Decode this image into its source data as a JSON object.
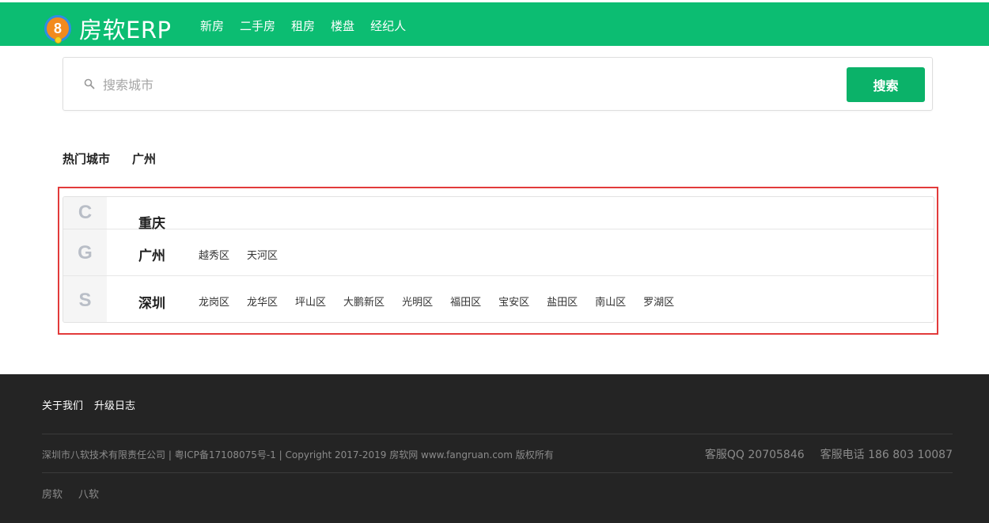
{
  "header": {
    "logo_number": "8",
    "brand": "房软ERP",
    "nav": [
      "新房",
      "二手房",
      "租房",
      "楼盘",
      "经纪人"
    ],
    "brand_color": "#0cbd72"
  },
  "search": {
    "placeholder": "搜索城市",
    "value": "",
    "button_label": "搜索",
    "button_color": "#0bb269"
  },
  "hot_cities": {
    "label": "热门城市",
    "cities": [
      "广州"
    ]
  },
  "city_groups": [
    {
      "letter": "C",
      "city": "重庆",
      "districts": []
    },
    {
      "letter": "G",
      "city": "广州",
      "districts": [
        "越秀区",
        "天河区"
      ]
    },
    {
      "letter": "S",
      "city": "深圳",
      "districts": [
        "龙岗区",
        "龙华区",
        "坪山区",
        "大鹏新区",
        "光明区",
        "福田区",
        "宝安区",
        "盐田区",
        "南山区",
        "罗湖区"
      ]
    }
  ],
  "footer": {
    "links": [
      "关于我们",
      "升级日志"
    ],
    "copyright": "深圳市八软技术有限责任公司 | 粤ICP备17108075号-1 | Copyright 2017-2019 房软网 www.fangruan.com 版权所有",
    "service_qq": "客服QQ 20705846",
    "service_phone": "客服电话 186 803 10087",
    "friend_links": [
      "房软",
      "八软"
    ]
  }
}
